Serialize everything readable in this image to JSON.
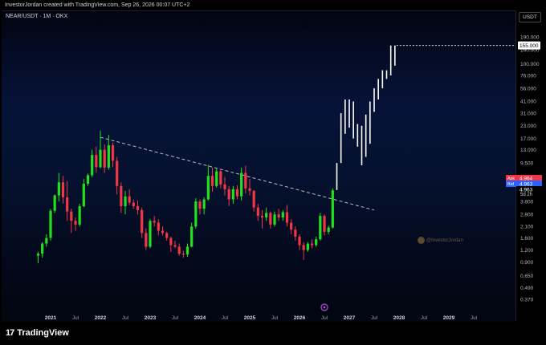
{
  "header": {
    "attribution": "InvestorJordan created with TradingView.com, Sep 26, 2026 00:07 UTC+2"
  },
  "toolbar": {
    "symbol": "NEAR/USDT · 1M · OKX",
    "currency": "USDT"
  },
  "watermark": "@InvestorJordan",
  "footer": {
    "brand": "TradingView",
    "brand_icon": "tradingview-logo-icon"
  },
  "colors": {
    "up": "#22e01b",
    "down": "#f23645",
    "projection": "#ffffff",
    "trendline": "#b8bcc8",
    "ask": "#f23645",
    "bid": "#2962ff",
    "last": "#000000",
    "event_marker": "#b04be0"
  },
  "chart_data": {
    "type": "candlestick",
    "interval": "1M",
    "y_scale": "log",
    "y_ticks": [
      190.0,
      140.0,
      100.0,
      76.0,
      56.0,
      41.0,
      31.0,
      23.0,
      17.0,
      13.0,
      9.5,
      3.8,
      2.8,
      2.1,
      1.6,
      1.2,
      0.9,
      0.65,
      0.49,
      0.37
    ],
    "y_tick_labels": [
      "190.000",
      "140.000",
      "100.000",
      "76.000",
      "56.000",
      "41.000",
      "31.000",
      "23.000",
      "17.000",
      "13.000",
      "9.500",
      "3.800",
      "2.800",
      "2.100",
      "1.600",
      "1.200",
      "0.900",
      "0.650",
      "0.490",
      "0.370"
    ],
    "x_labels": [
      "2021",
      "Jul",
      "2022",
      "Jul",
      "2023",
      "Jul",
      "2024",
      "Jul",
      "2025",
      "Jul",
      "2026",
      "Jul",
      "2027",
      "Jul",
      "2028",
      "Jul",
      "2029",
      "Jul"
    ],
    "x_label_dates": [
      "2021-01",
      "2021-07",
      "2022-01",
      "2022-07",
      "2023-01",
      "2023-07",
      "2024-01",
      "2024-07",
      "2025-01",
      "2025-07",
      "2026-01",
      "2026-07",
      "2027-01",
      "2027-07",
      "2028-01",
      "2028-07",
      "2029-01",
      "2029-07"
    ],
    "candles": [
      {
        "t": "2020-10",
        "o": 1.05,
        "h": 1.15,
        "l": 0.88,
        "c": 1.1
      },
      {
        "t": "2020-11",
        "o": 1.1,
        "h": 1.45,
        "l": 1.0,
        "c": 1.4
      },
      {
        "t": "2020-12",
        "o": 1.4,
        "h": 1.75,
        "l": 1.3,
        "c": 1.6
      },
      {
        "t": "2021-01",
        "o": 1.6,
        "h": 3.2,
        "l": 1.5,
        "c": 3.05
      },
      {
        "t": "2021-02",
        "o": 3.05,
        "h": 4.5,
        "l": 2.9,
        "c": 4.4
      },
      {
        "t": "2021-03",
        "o": 4.4,
        "h": 7.5,
        "l": 3.8,
        "c": 6.0
      },
      {
        "t": "2021-04",
        "o": 6.0,
        "h": 7.0,
        "l": 3.6,
        "c": 4.2
      },
      {
        "t": "2021-05",
        "o": 4.2,
        "h": 6.2,
        "l": 2.4,
        "c": 3.0
      },
      {
        "t": "2021-06",
        "o": 3.0,
        "h": 3.2,
        "l": 1.8,
        "c": 2.4
      },
      {
        "t": "2021-07",
        "o": 2.4,
        "h": 2.6,
        "l": 1.9,
        "c": 2.2
      },
      {
        "t": "2021-08",
        "o": 2.2,
        "h": 3.6,
        "l": 2.1,
        "c": 3.4
      },
      {
        "t": "2021-09",
        "o": 3.4,
        "h": 6.5,
        "l": 3.3,
        "c": 5.8
      },
      {
        "t": "2021-10",
        "o": 5.8,
        "h": 7.4,
        "l": 5.5,
        "c": 7.1
      },
      {
        "t": "2021-11",
        "o": 7.1,
        "h": 13.0,
        "l": 6.8,
        "c": 11.5
      },
      {
        "t": "2021-12",
        "o": 11.5,
        "h": 14.0,
        "l": 7.5,
        "c": 8.6
      },
      {
        "t": "2022-01",
        "o": 8.6,
        "h": 20.5,
        "l": 8.4,
        "c": 13.0
      },
      {
        "t": "2022-02",
        "o": 13.0,
        "h": 14.8,
        "l": 7.5,
        "c": 8.5
      },
      {
        "t": "2022-03",
        "o": 8.5,
        "h": 18.5,
        "l": 8.1,
        "c": 14.5
      },
      {
        "t": "2022-04",
        "o": 14.5,
        "h": 15.5,
        "l": 8.6,
        "c": 10.0
      },
      {
        "t": "2022-05",
        "o": 10.0,
        "h": 11.0,
        "l": 4.5,
        "c": 5.5
      },
      {
        "t": "2022-06",
        "o": 5.5,
        "h": 6.0,
        "l": 2.9,
        "c": 3.4
      },
      {
        "t": "2022-07",
        "o": 3.4,
        "h": 4.9,
        "l": 2.8,
        "c": 4.3
      },
      {
        "t": "2022-08",
        "o": 4.3,
        "h": 5.1,
        "l": 3.5,
        "c": 3.7
      },
      {
        "t": "2022-09",
        "o": 3.7,
        "h": 4.0,
        "l": 3.2,
        "c": 3.4
      },
      {
        "t": "2022-10",
        "o": 3.4,
        "h": 3.9,
        "l": 2.8,
        "c": 3.1
      },
      {
        "t": "2022-11",
        "o": 3.1,
        "h": 3.3,
        "l": 1.6,
        "c": 1.8
      },
      {
        "t": "2022-12",
        "o": 1.8,
        "h": 2.0,
        "l": 1.2,
        "c": 1.3
      },
      {
        "t": "2023-01",
        "o": 1.3,
        "h": 2.5,
        "l": 1.25,
        "c": 2.4
      },
      {
        "t": "2023-02",
        "o": 2.4,
        "h": 2.7,
        "l": 2.1,
        "c": 2.3
      },
      {
        "t": "2023-03",
        "o": 2.3,
        "h": 2.5,
        "l": 1.7,
        "c": 1.9
      },
      {
        "t": "2023-04",
        "o": 1.9,
        "h": 2.1,
        "l": 1.7,
        "c": 1.8
      },
      {
        "t": "2023-05",
        "o": 1.8,
        "h": 1.85,
        "l": 1.5,
        "c": 1.6
      },
      {
        "t": "2023-06",
        "o": 1.6,
        "h": 1.65,
        "l": 1.15,
        "c": 1.35
      },
      {
        "t": "2023-07",
        "o": 1.35,
        "h": 1.5,
        "l": 1.25,
        "c": 1.3
      },
      {
        "t": "2023-08",
        "o": 1.3,
        "h": 1.4,
        "l": 1.05,
        "c": 1.1
      },
      {
        "t": "2023-09",
        "o": 1.1,
        "h": 1.18,
        "l": 1.0,
        "c": 1.08
      },
      {
        "t": "2023-10",
        "o": 1.08,
        "h": 1.4,
        "l": 1.02,
        "c": 1.3
      },
      {
        "t": "2023-11",
        "o": 1.3,
        "h": 2.3,
        "l": 1.28,
        "c": 2.1
      },
      {
        "t": "2023-12",
        "o": 2.1,
        "h": 4.1,
        "l": 2.0,
        "c": 3.8
      },
      {
        "t": "2024-01",
        "o": 3.8,
        "h": 4.0,
        "l": 2.8,
        "c": 3.2
      },
      {
        "t": "2024-02",
        "o": 3.2,
        "h": 4.2,
        "l": 2.8,
        "c": 4.0
      },
      {
        "t": "2024-03",
        "o": 4.0,
        "h": 9.1,
        "l": 3.9,
        "c": 7.0
      },
      {
        "t": "2024-04",
        "o": 7.0,
        "h": 8.5,
        "l": 4.8,
        "c": 5.5
      },
      {
        "t": "2024-05",
        "o": 5.5,
        "h": 8.3,
        "l": 5.3,
        "c": 7.8
      },
      {
        "t": "2024-06",
        "o": 7.8,
        "h": 8.2,
        "l": 5.2,
        "c": 5.7
      },
      {
        "t": "2024-07",
        "o": 5.7,
        "h": 6.8,
        "l": 4.4,
        "c": 5.1
      },
      {
        "t": "2024-08",
        "o": 5.1,
        "h": 5.5,
        "l": 3.4,
        "c": 4.0
      },
      {
        "t": "2024-09",
        "o": 4.0,
        "h": 5.5,
        "l": 3.6,
        "c": 5.1
      },
      {
        "t": "2024-10",
        "o": 5.1,
        "h": 5.6,
        "l": 4.0,
        "c": 4.3
      },
      {
        "t": "2024-11",
        "o": 4.3,
        "h": 8.5,
        "l": 3.9,
        "c": 7.5
      },
      {
        "t": "2024-12",
        "o": 7.5,
        "h": 8.9,
        "l": 4.6,
        "c": 5.2
      },
      {
        "t": "2025-01",
        "o": 5.2,
        "h": 6.5,
        "l": 4.4,
        "c": 4.9
      },
      {
        "t": "2025-02",
        "o": 4.9,
        "h": 5.0,
        "l": 3.0,
        "c": 3.3
      },
      {
        "t": "2025-03",
        "o": 3.3,
        "h": 3.6,
        "l": 2.4,
        "c": 2.7
      },
      {
        "t": "2025-04",
        "o": 2.7,
        "h": 3.1,
        "l": 2.0,
        "c": 2.6
      },
      {
        "t": "2025-05",
        "o": 2.6,
        "h": 3.3,
        "l": 2.4,
        "c": 2.9
      },
      {
        "t": "2025-06",
        "o": 2.9,
        "h": 3.0,
        "l": 2.0,
        "c": 2.2
      },
      {
        "t": "2025-07",
        "o": 2.2,
        "h": 3.0,
        "l": 2.1,
        "c": 2.8
      },
      {
        "t": "2025-08",
        "o": 2.8,
        "h": 3.2,
        "l": 2.4,
        "c": 2.6
      },
      {
        "t": "2025-09",
        "o": 2.6,
        "h": 3.1,
        "l": 2.4,
        "c": 2.95
      },
      {
        "t": "2025-10",
        "o": 2.95,
        "h": 3.5,
        "l": 2.1,
        "c": 2.3
      },
      {
        "t": "2025-11",
        "o": 2.3,
        "h": 2.5,
        "l": 1.75,
        "c": 1.95
      },
      {
        "t": "2025-12",
        "o": 1.95,
        "h": 2.1,
        "l": 1.5,
        "c": 1.65
      },
      {
        "t": "2026-01",
        "o": 1.65,
        "h": 1.75,
        "l": 1.2,
        "c": 1.35
      },
      {
        "t": "2026-02",
        "o": 1.35,
        "h": 1.45,
        "l": 0.95,
        "c": 1.2
      },
      {
        "t": "2026-03",
        "o": 1.2,
        "h": 1.45,
        "l": 1.15,
        "c": 1.4
      },
      {
        "t": "2026-04",
        "o": 1.4,
        "h": 1.55,
        "l": 1.25,
        "c": 1.35
      },
      {
        "t": "2026-05",
        "o": 1.35,
        "h": 1.65,
        "l": 1.3,
        "c": 1.55
      },
      {
        "t": "2026-06",
        "o": 1.55,
        "h": 2.9,
        "l": 1.5,
        "c": 2.7
      },
      {
        "t": "2026-07",
        "o": 2.7,
        "h": 2.8,
        "l": 1.7,
        "c": 1.85
      },
      {
        "t": "2026-08",
        "o": 1.85,
        "h": 2.15,
        "l": 1.75,
        "c": 2.05
      },
      {
        "t": "2026-09",
        "o": 2.05,
        "h": 5.2,
        "l": 2.0,
        "c": 4.96
      }
    ],
    "projection_bars": [
      {
        "t": "2026-10",
        "lo": 5.0,
        "hi": 9.5
      },
      {
        "t": "2026-11",
        "lo": 9.5,
        "hi": 31.0
      },
      {
        "t": "2026-12",
        "lo": 19.0,
        "hi": 43.0
      },
      {
        "t": "2027-01",
        "lo": 22.0,
        "hi": 43.0
      },
      {
        "t": "2027-02",
        "lo": 17.0,
        "hi": 41.0
      },
      {
        "t": "2027-03",
        "lo": 14.0,
        "hi": 24.0
      },
      {
        "t": "2027-04",
        "lo": 9.0,
        "hi": 23.0
      },
      {
        "t": "2027-05",
        "lo": 11.0,
        "hi": 30.0
      },
      {
        "t": "2027-06",
        "lo": 15.0,
        "hi": 41.0
      },
      {
        "t": "2027-07",
        "lo": 32.0,
        "hi": 56.0
      },
      {
        "t": "2027-08",
        "lo": 43.0,
        "hi": 70.0
      },
      {
        "t": "2027-09",
        "lo": 56.0,
        "hi": 86.0
      },
      {
        "t": "2027-10",
        "lo": 70.0,
        "hi": 86.0
      },
      {
        "t": "2027-11",
        "lo": 76.0,
        "hi": 155.0
      },
      {
        "t": "2027-12",
        "lo": 96.0,
        "hi": 155.0
      }
    ],
    "trendline": {
      "from": {
        "t": "2022-01",
        "v": 17.5
      },
      "to": {
        "t": "2027-07",
        "v": 3.1
      }
    },
    "target": {
      "value": 155.0,
      "label": "155.000",
      "from_t": "2027-12"
    },
    "price_tags": [
      {
        "name": "Ask",
        "value": 4.964,
        "label": "4.964",
        "kind": "ask"
      },
      {
        "name": "Bid",
        "value": 4.963,
        "label": "4.963",
        "kind": "bid"
      },
      {
        "name": "",
        "value": 4.963,
        "label": "4.963",
        "kind": "last"
      }
    ],
    "countdown": "5d 2h",
    "event_marker": {
      "t": "2026-07"
    }
  }
}
